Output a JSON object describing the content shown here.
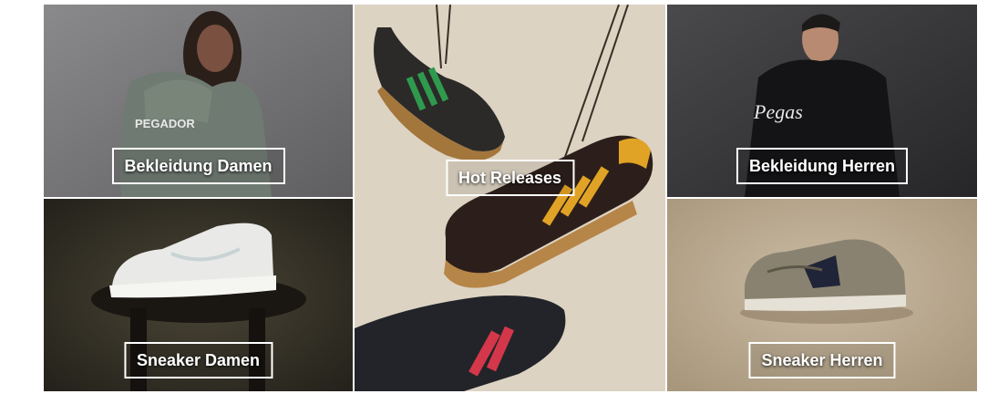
{
  "tiles": {
    "bekleidung_damen": {
      "label": "Bekleidung Damen"
    },
    "sneaker_damen": {
      "label": "Sneaker Damen"
    },
    "hot_releases": {
      "label": "Hot Releases"
    },
    "bekleidung_herren": {
      "label": "Bekleidung Herren"
    },
    "sneaker_herren": {
      "label": "Sneaker Herren"
    }
  },
  "image_text": {
    "hoodie_print": "PEGADOR",
    "sweatshirt_script": "Pegas"
  },
  "colors": {
    "label_border": "#ffffff",
    "label_text": "#ffffff"
  }
}
